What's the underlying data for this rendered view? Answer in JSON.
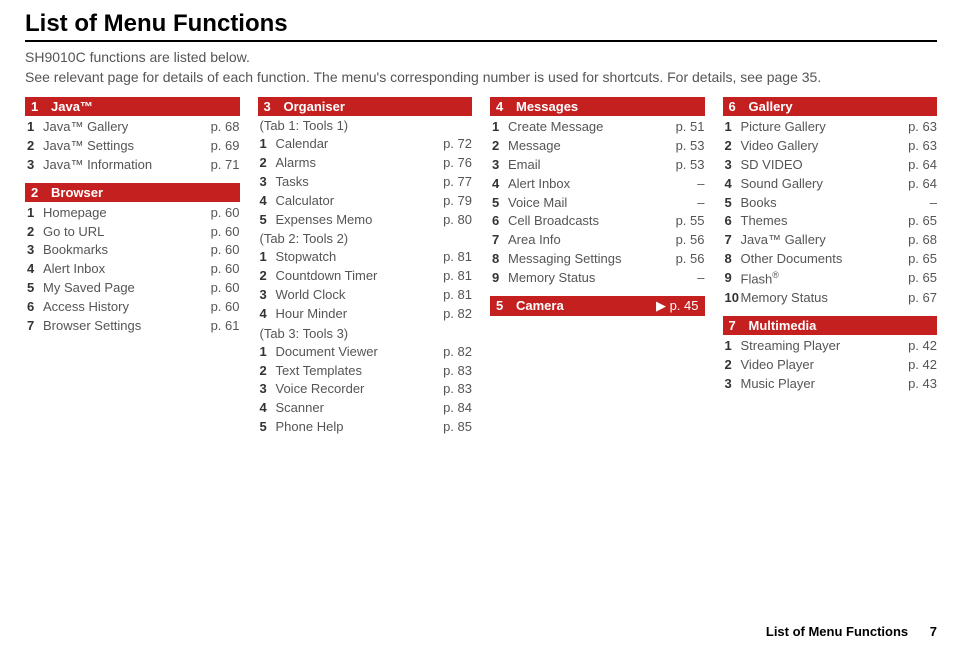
{
  "title": "List of Menu Functions",
  "intro_line1": "SH9010C functions are listed below.",
  "intro_line2": "See relevant page for details of each function. The menu's corresponding number is used for shortcuts. For details, see page 35.",
  "footer_title": "List of Menu Functions",
  "footer_page": "7",
  "columns": [
    {
      "sections": [
        {
          "num": "1",
          "title": "Java™",
          "items": [
            {
              "num": "1",
              "label": "Java™ Gallery",
              "page": "p. 68"
            },
            {
              "num": "2",
              "label": "Java™ Settings",
              "page": "p. 69"
            },
            {
              "num": "3",
              "label": "Java™ Information",
              "page": "p. 71"
            }
          ]
        },
        {
          "num": "2",
          "title": "Browser",
          "items": [
            {
              "num": "1",
              "label": "Homepage",
              "page": "p. 60"
            },
            {
              "num": "2",
              "label": "Go to URL",
              "page": "p. 60"
            },
            {
              "num": "3",
              "label": "Bookmarks",
              "page": "p. 60"
            },
            {
              "num": "4",
              "label": "Alert Inbox",
              "page": "p. 60"
            },
            {
              "num": "5",
              "label": "My Saved Page",
              "page": "p. 60"
            },
            {
              "num": "6",
              "label": "Access History",
              "page": "p. 60"
            },
            {
              "num": "7",
              "label": "Browser Settings",
              "page": "p. 61"
            }
          ]
        }
      ]
    },
    {
      "sections": [
        {
          "num": "3",
          "title": "Organiser",
          "groups": [
            {
              "tab": "(Tab 1: Tools 1)",
              "items": [
                {
                  "num": "1",
                  "label": "Calendar",
                  "page": "p. 72"
                },
                {
                  "num": "2",
                  "label": "Alarms",
                  "page": "p. 76"
                },
                {
                  "num": "3",
                  "label": "Tasks",
                  "page": "p. 77"
                },
                {
                  "num": "4",
                  "label": "Calculator",
                  "page": "p. 79"
                },
                {
                  "num": "5",
                  "label": "Expenses Memo",
                  "page": "p. 80"
                }
              ]
            },
            {
              "tab": "(Tab 2: Tools 2)",
              "items": [
                {
                  "num": "1",
                  "label": "Stopwatch",
                  "page": "p. 81"
                },
                {
                  "num": "2",
                  "label": "Countdown Timer",
                  "page": "p. 81"
                },
                {
                  "num": "3",
                  "label": "World Clock",
                  "page": "p. 81"
                },
                {
                  "num": "4",
                  "label": "Hour Minder",
                  "page": "p. 82"
                }
              ]
            },
            {
              "tab": "(Tab 3: Tools 3)",
              "items": [
                {
                  "num": "1",
                  "label": "Document Viewer",
                  "page": "p. 82"
                },
                {
                  "num": "2",
                  "label": "Text Templates",
                  "page": "p. 83"
                },
                {
                  "num": "3",
                  "label": "Voice Recorder",
                  "page": "p. 83"
                },
                {
                  "num": "4",
                  "label": "Scanner",
                  "page": "p. 84"
                },
                {
                  "num": "5",
                  "label": "Phone Help",
                  "page": "p. 85"
                }
              ]
            }
          ]
        }
      ]
    },
    {
      "sections": [
        {
          "num": "4",
          "title": "Messages",
          "items": [
            {
              "num": "1",
              "label": "Create Message",
              "page": "p. 51"
            },
            {
              "num": "2",
              "label": "Message",
              "page": "p. 53"
            },
            {
              "num": "3",
              "label": "Email",
              "page": "p. 53"
            },
            {
              "num": "4",
              "label": "Alert Inbox",
              "page": "–"
            },
            {
              "num": "5",
              "label": "Voice Mail",
              "page": "–"
            },
            {
              "num": "6",
              "label": "Cell Broadcasts",
              "page": "p. 55"
            },
            {
              "num": "7",
              "label": "Area Info",
              "page": "p. 56"
            },
            {
              "num": "8",
              "label": "Messaging Settings",
              "page": "p. 56"
            },
            {
              "num": "9",
              "label": "Memory Status",
              "page": "–"
            }
          ]
        },
        {
          "num": "5",
          "title": "Camera",
          "header_page": "▶ p. 45"
        }
      ]
    },
    {
      "sections": [
        {
          "num": "6",
          "title": "Gallery",
          "items": [
            {
              "num": "1",
              "label": "Picture Gallery",
              "page": "p. 63"
            },
            {
              "num": "2",
              "label": "Video Gallery",
              "page": "p. 63"
            },
            {
              "num": "3",
              "label": "SD VIDEO",
              "page": "p. 64"
            },
            {
              "num": "4",
              "label": "Sound Gallery",
              "page": "p. 64"
            },
            {
              "num": "5",
              "label": "Books",
              "page": "–"
            },
            {
              "num": "6",
              "label": "Themes",
              "page": "p. 65"
            },
            {
              "num": "7",
              "label": "Java™ Gallery",
              "page": "p. 68"
            },
            {
              "num": "8",
              "label": "Other Documents",
              "page": "p. 65"
            },
            {
              "num": "9",
              "label": "Flash®",
              "page": "p. 65",
              "sup": true
            },
            {
              "num": "10",
              "label": "Memory Status",
              "page": "p. 67"
            }
          ]
        },
        {
          "num": "7",
          "title": "Multimedia",
          "items": [
            {
              "num": "1",
              "label": "Streaming Player",
              "page": "p. 42"
            },
            {
              "num": "2",
              "label": "Video Player",
              "page": "p. 42"
            },
            {
              "num": "3",
              "label": "Music Player",
              "page": "p. 43"
            }
          ]
        }
      ]
    }
  ]
}
